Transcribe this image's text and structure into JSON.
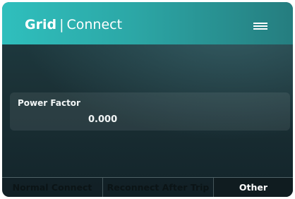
{
  "header": {
    "title_bold": "Grid",
    "title_separator": "|",
    "title_light": "Connect",
    "menu_icon": "hamburger-menu-icon"
  },
  "readout": {
    "label": "Power Factor",
    "value": "0.000"
  },
  "tabs": [
    {
      "label": "Normal Connect",
      "active": false
    },
    {
      "label": "Reconnect After Trip",
      "active": false
    },
    {
      "label": "Other",
      "active": true
    }
  ],
  "colors": {
    "header_start": "#2fbfbd",
    "header_end": "#257d7f",
    "background": "#1b3136",
    "active_tab_bg": "#101c20",
    "text": "#ffffff"
  }
}
